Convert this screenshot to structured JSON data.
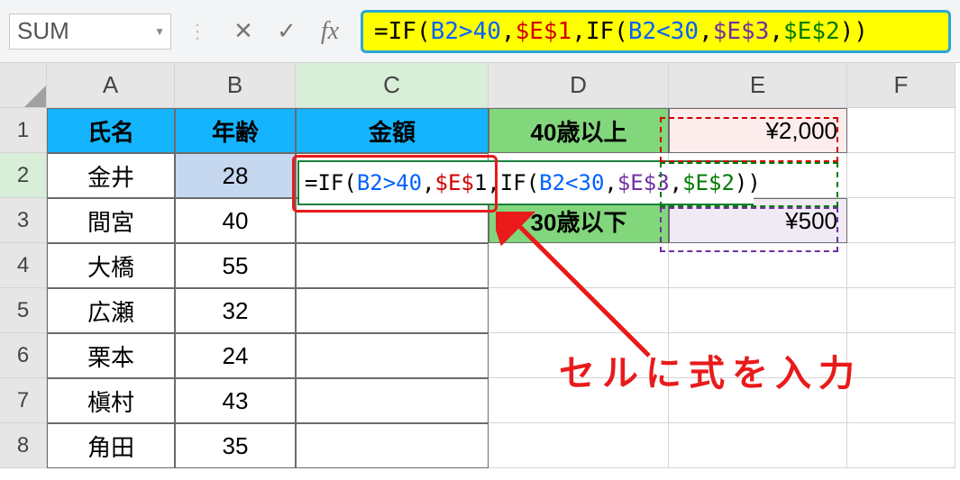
{
  "nameBox": "SUM",
  "formulaBar": {
    "eqIF1": "=IF",
    "p1": "(",
    "b2gt40": "B2>40",
    "c1": ",",
    "e1": "$E$1",
    "c2": ",",
    "if2": "IF",
    "p2": "(",
    "b2lt30": "B2<30",
    "c3": ",",
    "e3": "$E$3",
    "c4": ",",
    "e2": "$E$2",
    "pp": "))"
  },
  "cols": [
    "A",
    "B",
    "C",
    "D",
    "E",
    "F"
  ],
  "rows": [
    "1",
    "2",
    "3",
    "4",
    "5",
    "6",
    "7",
    "8"
  ],
  "headers": {
    "A": "氏名",
    "B": "年齢",
    "C": "金額"
  },
  "side": {
    "D1": "40歳以上",
    "E1": "¥2,000",
    "D3": "30歳以下",
    "E3": "¥500"
  },
  "data": {
    "A2": "金井",
    "B2": "28",
    "A3": "間宮",
    "B3": "40",
    "A4": "大橋",
    "B4": "55",
    "A5": "広瀬",
    "B5": "32",
    "A6": "栗本",
    "B6": "24",
    "A7": "槇村",
    "B7": "43",
    "A8": "角田",
    "B8": "35"
  },
  "cellFormula": {
    "eqIF1": "=IF",
    "p1": "(",
    "b2gt40": "B2>40",
    "c1": ",",
    "e1": "$E$",
    "e1b": "1",
    "c2": ",",
    "if2": "IF",
    "p2": "(",
    "b2lt30": "B2<30",
    "c3": ",",
    "e3": "$E$3",
    "c4": ",",
    "e2": "$E$2",
    "pp": "))"
  },
  "annotation": "セルに式を入力",
  "chart_data": {
    "type": "table",
    "title": "年齢/金額 IF関数 例",
    "columns": [
      "氏名",
      "年齢",
      "金額"
    ],
    "rows": [
      {
        "氏名": "金井",
        "年齢": 28,
        "金額": null
      },
      {
        "氏名": "間宮",
        "年齢": 40,
        "金額": null
      },
      {
        "氏名": "大橋",
        "年齢": 55,
        "金額": null
      },
      {
        "氏名": "広瀬",
        "年齢": 32,
        "金額": null
      },
      {
        "氏名": "栗本",
        "年齢": 24,
        "金額": null
      },
      {
        "氏名": "槇村",
        "年齢": 43,
        "金額": null
      },
      {
        "氏名": "角田",
        "年齢": 35,
        "金額": null
      }
    ],
    "lookup": [
      {
        "条件": "40歳以上",
        "金額": 2000
      },
      {
        "条件": "30歳以下",
        "金額": 500
      }
    ],
    "formula": "=IF(B2>40,$E$1,IF(B2<30,$E$3,$E$2))"
  }
}
